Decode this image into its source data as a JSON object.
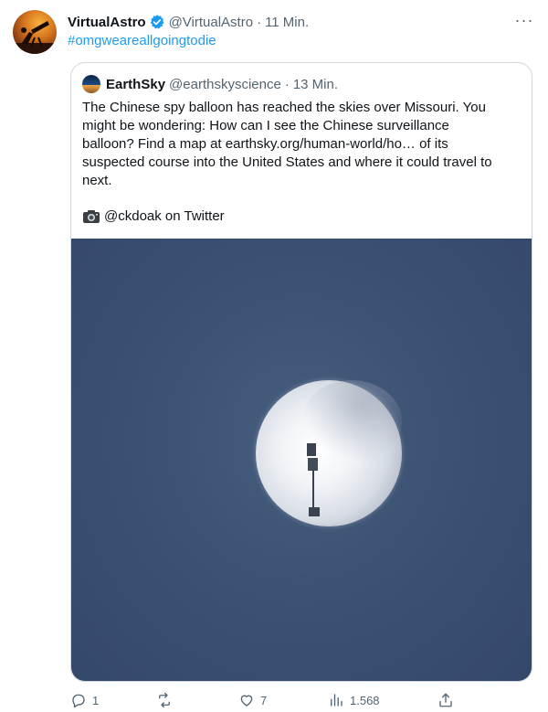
{
  "tweet": {
    "author_name": "VirtualAstro",
    "author_handle": "@VirtualAstro",
    "separator": "·",
    "time": "11 Min.",
    "more_label": "···",
    "hashtag": "#omgweareallgoingtodie"
  },
  "quote": {
    "author_name": "EarthSky",
    "author_handle": "@earthskyscience",
    "separator": "·",
    "time": "13 Min.",
    "text": "The Chinese spy balloon has reached the skies over Missouri. You\nmight be wondering: How can I see the Chinese surveillance\nballoon? Find a map at earthsky.org/human-world/ho…  of its\nsuspected course into the United States and where it could travel to\nnext.",
    "credit": "@ckdoak on Twitter"
  },
  "actions": {
    "replies": "1",
    "retweets": "",
    "likes": "7",
    "views": "1.568"
  },
  "colors": {
    "link": "#1d9bf0",
    "secondary_text": "#536471",
    "sky": "#3c5273"
  }
}
